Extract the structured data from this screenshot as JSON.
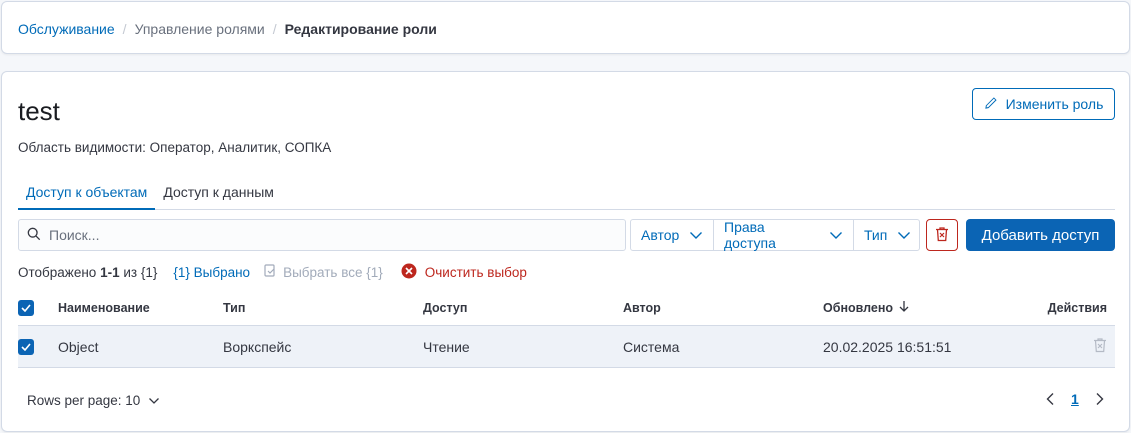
{
  "breadcrumb": {
    "item1": "Обслуживание",
    "item2": "Управление ролями",
    "current": "Редактирование роли"
  },
  "role": {
    "title": "test",
    "edit_label": "Изменить роль",
    "scope_label": "Область видимости:",
    "scope_value": "Оператор, Аналитик, СОПКА"
  },
  "tabs": [
    {
      "label": "Доступ к объектам",
      "active": true
    },
    {
      "label": "Доступ к данным",
      "active": false
    }
  ],
  "search": {
    "placeholder": "Поиск..."
  },
  "filters": {
    "author": "Автор",
    "rights": "Права доступа",
    "type": "Тип"
  },
  "add_button": "Добавить доступ",
  "status": {
    "shown_prefix": "Отображено",
    "shown_range": "1-1",
    "shown_of": "из {1}",
    "selected": "{1} Выбрано",
    "select_all": "Выбрать все {1}",
    "clear": "Очистить выбор"
  },
  "table": {
    "headers": {
      "name": "Наименование",
      "type": "Тип",
      "access": "Доступ",
      "author": "Автор",
      "updated": "Обновлено",
      "actions": "Действия"
    },
    "rows": [
      {
        "name": "Object",
        "type": "Воркспейс",
        "access": "Чтение",
        "author": "Система",
        "updated": "20.02.2025 16:51:51",
        "checked": true
      }
    ]
  },
  "pagination": {
    "rows_per_page": "Rows per page: 10",
    "current_page": "1"
  },
  "colors": {
    "primary": "#006bb8",
    "danger": "#bd271e",
    "selected_row": "#eef2f8"
  }
}
